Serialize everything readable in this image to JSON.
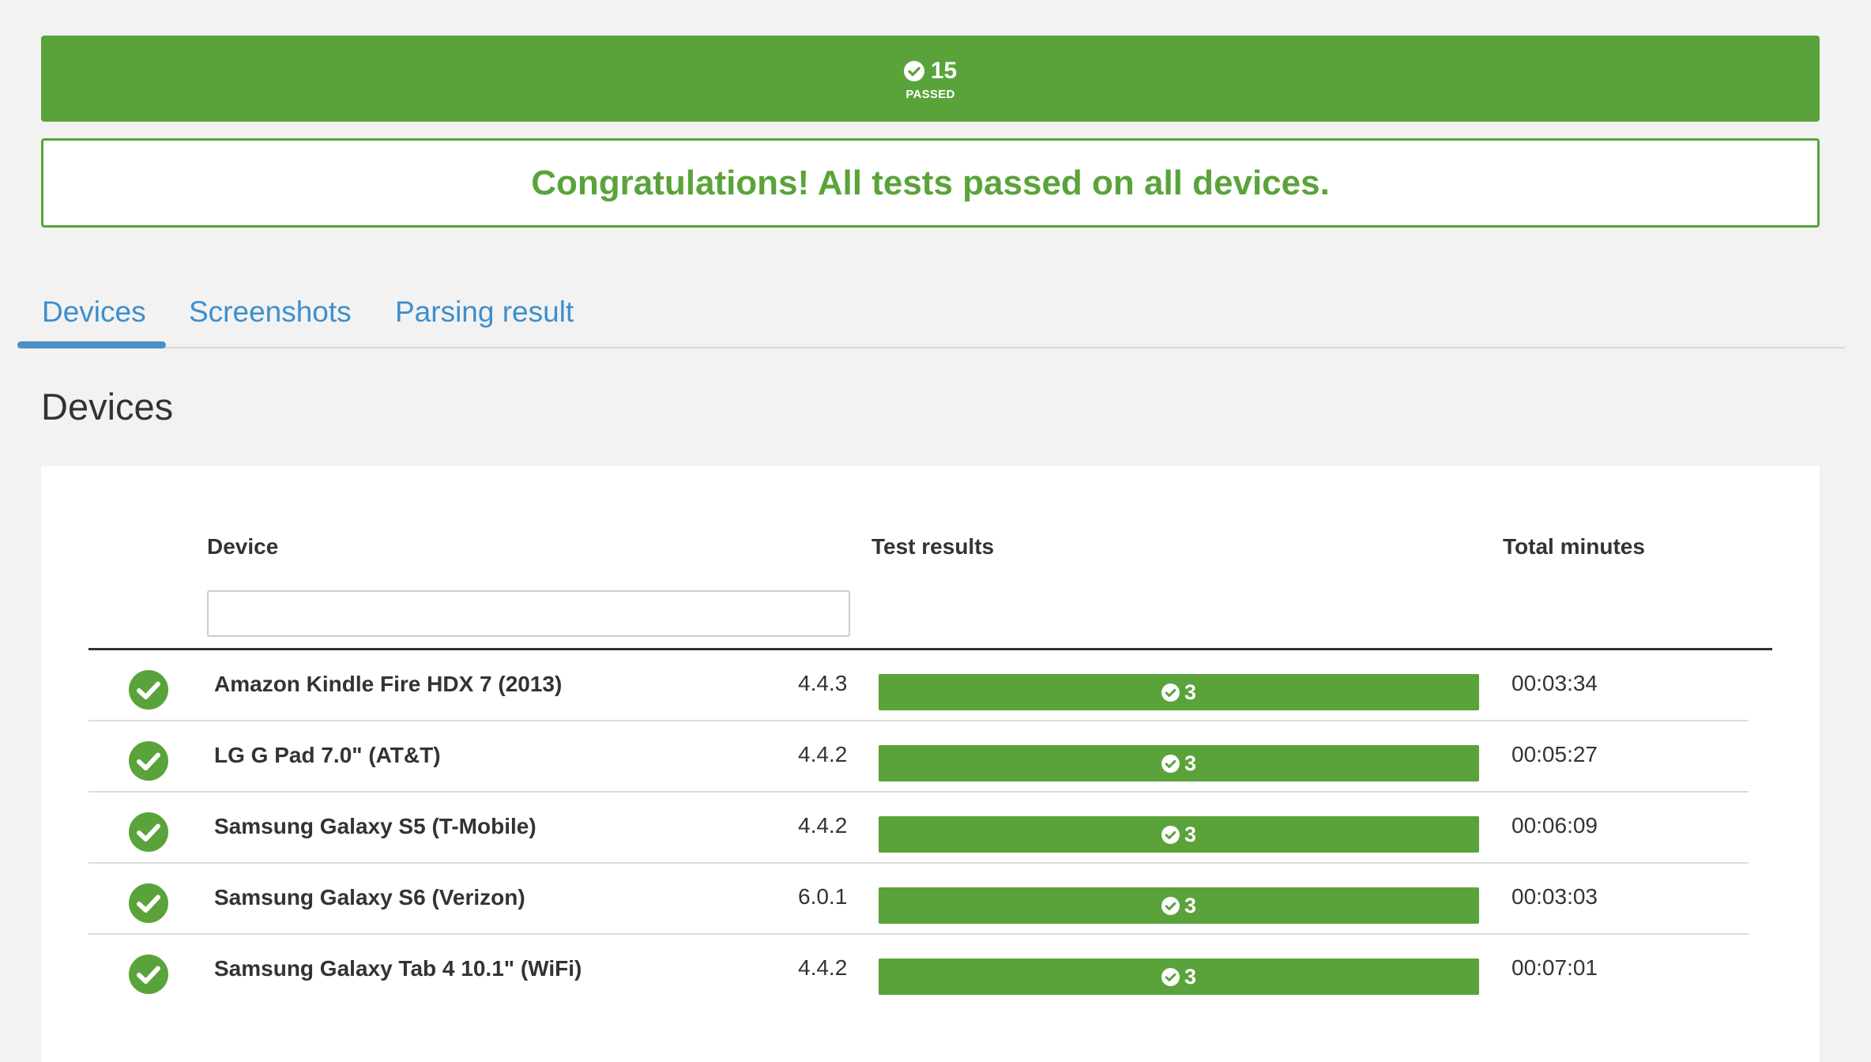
{
  "summary": {
    "passed_count": "15",
    "passed_label": "PASSED",
    "icon": "check-circle-icon",
    "color": "#5aa33a"
  },
  "banner": {
    "message": "Congratulations! All tests passed on all devices."
  },
  "tabs": [
    {
      "label": "Devices",
      "active": true
    },
    {
      "label": "Screenshots",
      "active": false
    },
    {
      "label": "Parsing result",
      "active": false
    }
  ],
  "section_title": "Devices",
  "table": {
    "headers": {
      "device": "Device",
      "test_results": "Test results",
      "total_minutes": "Total minutes"
    },
    "filter_value": "",
    "rows": [
      {
        "status": "passed",
        "device": "Amazon Kindle Fire HDX 7 (2013)",
        "os": "4.4.3",
        "passed": "3",
        "minutes": "00:03:34"
      },
      {
        "status": "passed",
        "device": "LG G Pad 7.0\" (AT&T)",
        "os": "4.4.2",
        "passed": "3",
        "minutes": "00:05:27"
      },
      {
        "status": "passed",
        "device": "Samsung Galaxy S5 (T-Mobile)",
        "os": "4.4.2",
        "passed": "3",
        "minutes": "00:06:09"
      },
      {
        "status": "passed",
        "device": "Samsung Galaxy S6 (Verizon)",
        "os": "6.0.1",
        "passed": "3",
        "minutes": "00:03:03"
      },
      {
        "status": "passed",
        "device": "Samsung Galaxy Tab 4 10.1\" (WiFi)",
        "os": "4.4.2",
        "passed": "3",
        "minutes": "00:07:01"
      }
    ]
  }
}
